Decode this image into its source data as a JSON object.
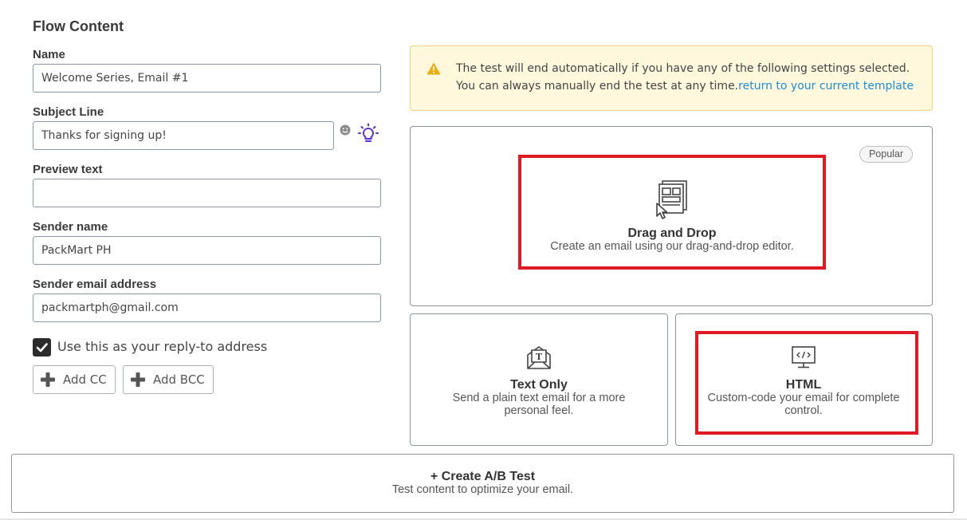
{
  "section": {
    "title": "Flow Content"
  },
  "form": {
    "name": {
      "label": "Name",
      "value": "Welcome Series, Email #1"
    },
    "subject": {
      "label": "Subject Line",
      "value": "Thanks for signing up!"
    },
    "preview": {
      "label": "Preview text",
      "value": ""
    },
    "sender_name": {
      "label": "Sender name",
      "value": "PackMart PH"
    },
    "sender_email": {
      "label": "Sender email address",
      "value": "packmartph@gmail.com"
    },
    "reply_to": {
      "label": "Use this as your reply-to address",
      "checked": true
    },
    "add_cc": "Add CC",
    "add_bcc": "Add BCC"
  },
  "alert": {
    "line1": "The test will end automatically if you have any of the following settings selected.",
    "line2": "You can always manually end the test at any time.",
    "link": "return to your current template"
  },
  "templates": {
    "drag_drop": {
      "title": "Drag and Drop",
      "desc": "Create an email using our drag-and-drop editor.",
      "badge": "Popular"
    },
    "text_only": {
      "title": "Text Only",
      "desc": "Send a plain text email for a more personal feel."
    },
    "html": {
      "title": "HTML",
      "desc": "Custom-code your email for complete control."
    }
  },
  "ab_test": {
    "title": "+ Create A/B Test",
    "desc": "Test content to optimize your email."
  },
  "colors": {
    "accent_purple": "#5a2fd6",
    "link_blue": "#1b8ed6",
    "highlight_red": "#e01b24",
    "alert_bg": "#fff8dc"
  },
  "icons": [
    "emoji-icon",
    "lightbulb-icon",
    "checkmark-icon",
    "plus-icon",
    "warning-icon",
    "drag-drop-icon",
    "envelope-text-icon",
    "code-monitor-icon"
  ]
}
